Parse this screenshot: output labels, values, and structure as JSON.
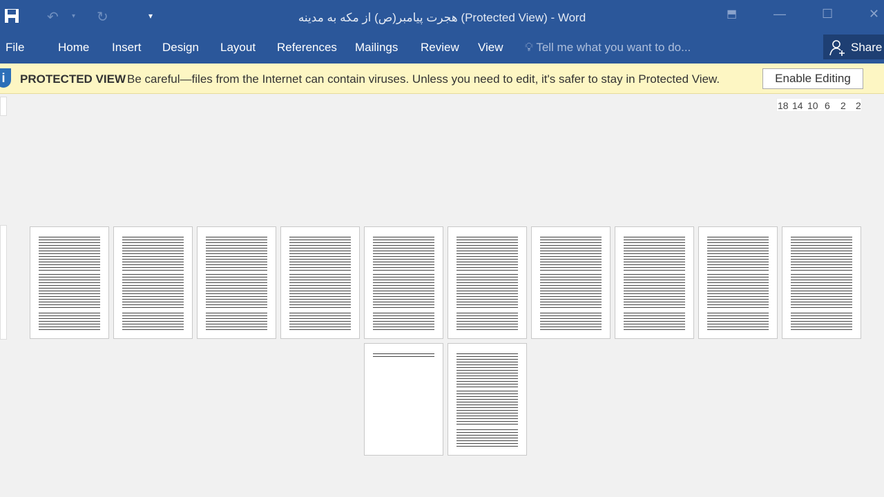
{
  "window": {
    "title": "هجرت پیامبر(ص) از مکه به مدینه (Protected View) - Word"
  },
  "quick_access": {
    "save": "save-icon",
    "undo": "undo-icon",
    "redo": "redo-icon",
    "customize": "customize-icon"
  },
  "tabs": [
    "File",
    "Home",
    "Insert",
    "Design",
    "Layout",
    "References",
    "Mailings",
    "Review",
    "View"
  ],
  "tell_me": {
    "placeholder": "Tell me what you want to do..."
  },
  "share": {
    "label": "Share"
  },
  "protected_view": {
    "title": "PROTECTED VIEW",
    "message": "Be careful—files from the Internet can contain viruses. Unless you need to edit, it's safer to stay in Protected View.",
    "button": "Enable Editing"
  },
  "ruler": {
    "ticks": [
      "18",
      "14",
      "10",
      "6",
      "2",
      "2"
    ]
  },
  "pages": {
    "count": 12
  }
}
